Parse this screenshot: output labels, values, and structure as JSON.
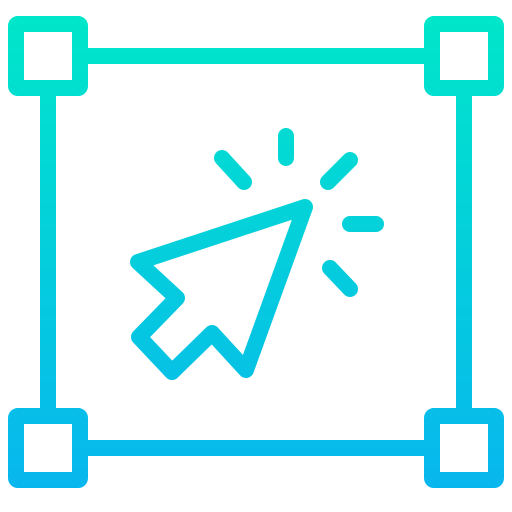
{
  "icon": {
    "name": "select-area-cursor-icon",
    "gradient": {
      "top": "#00E8C8",
      "bottom": "#08B4F0"
    },
    "background": "#FFFFFF"
  }
}
